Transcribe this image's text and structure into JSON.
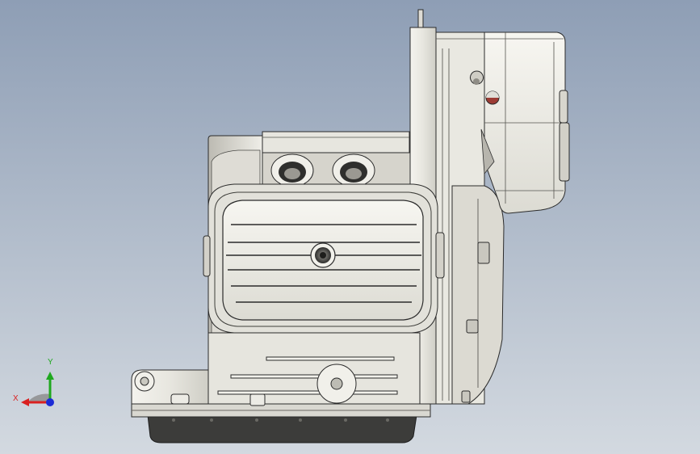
{
  "viewport": {
    "background_top": "#8f9fb6",
    "background_bottom": "#cfd6de"
  },
  "model": {
    "icon": "engine-block-model",
    "body_color": "#e9e8e2",
    "edge_color": "#2b2b2b",
    "shadow_color": "#8c8b86",
    "base_color": "#3a3a38"
  },
  "triad": {
    "x_label": "X",
    "y_label": "Y",
    "x_color": "#d92020",
    "y_color": "#1fa81f",
    "z_color": "#1c2bd6",
    "plane_color": "#8e8e8e"
  }
}
